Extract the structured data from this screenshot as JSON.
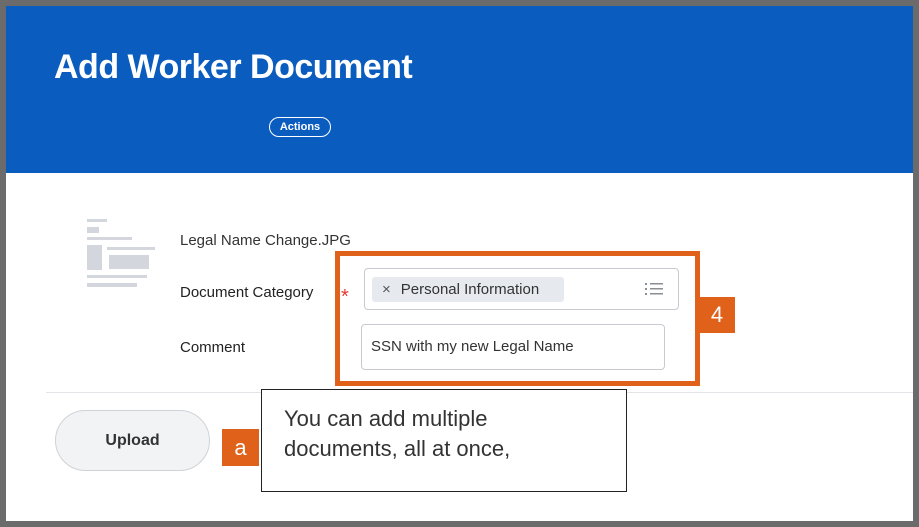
{
  "header": {
    "title": "Add Worker Document",
    "actions_label": "Actions"
  },
  "document": {
    "file_name": "Legal Name Change.JPG"
  },
  "form": {
    "category_label": "Document Category",
    "required_mark": "*",
    "category_value": "Personal Information",
    "remove_icon": "×",
    "comment_label": "Comment",
    "comment_value": "SSN with my new Legal Name"
  },
  "footer": {
    "upload_label": "Upload"
  },
  "annotations": {
    "step_badge": "4",
    "callout_badge": "a",
    "callout_line1": "You can add multiple",
    "callout_line2": "documents, all at once,"
  },
  "colors": {
    "header_blue": "#0b5cbf",
    "highlight_orange": "#e0611a",
    "required_red": "#e53935"
  },
  "icons": {
    "list": "list-icon",
    "remove": "close-icon"
  }
}
